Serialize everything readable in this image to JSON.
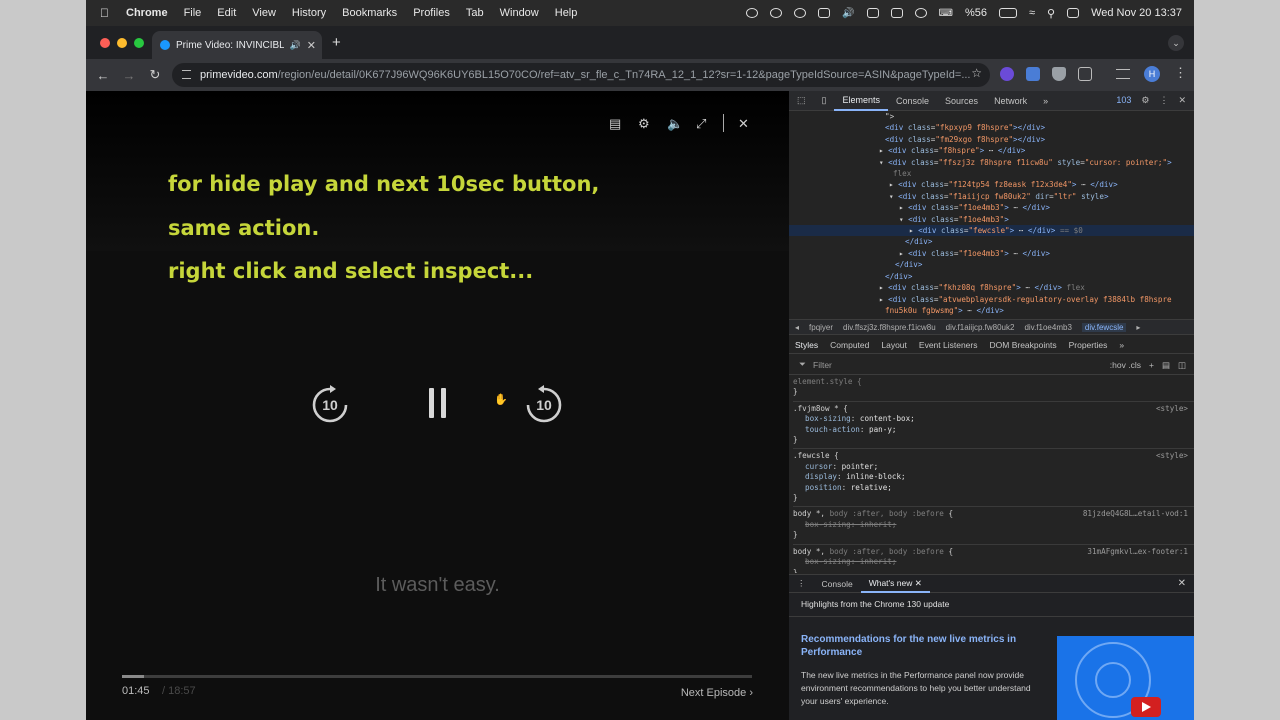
{
  "menubar": {
    "app": "Chrome",
    "items": [
      "File",
      "Edit",
      "View",
      "History",
      "Bookmarks",
      "Profiles",
      "Tab",
      "Window",
      "Help"
    ],
    "battery": "%56",
    "datetime": "Wed Nov 20  13:37"
  },
  "tab": {
    "title": "Prime Video: INVINCIBLE"
  },
  "address": {
    "host": "primevideo.com",
    "path": "/region/eu/detail/0K677J96WQ96K6UY6BL15O70CO/ref=atv_sr_fle_c_Tn74RA_12_1_12?sr=1-12&pageTypeIdSource=ASIN&pageTypeId=..."
  },
  "profile": {
    "initial": "H"
  },
  "video": {
    "caption_lines": [
      "for hide play and next 10sec button,",
      "same action.",
      "right click and select inspect..."
    ],
    "skip_back": "10",
    "skip_forward": "10",
    "subtitle": "It wasn't easy.",
    "time_current": "01:45",
    "time_total": "/ 18:57",
    "progress": 0.035,
    "next_episode": "Next Episode ›"
  },
  "devtools": {
    "tabs": [
      "Elements",
      "Console",
      "Sources",
      "Network"
    ],
    "issues_count": "103",
    "breadcrumbs": [
      "fpqiyer",
      "div.ffszj3z.f8hspre.f1icw8u",
      "div.f1aiijcp.fw80uk2",
      "div.f1oe4mb3",
      "div.fewcsle"
    ],
    "style_tabs": [
      "Styles",
      "Computed",
      "Layout",
      "Event Listeners",
      "DOM Breakpoints",
      "Properties"
    ],
    "filter_placeholder": "Filter",
    "filter_tools": ":hov  .cls",
    "drawer_tabs": [
      "Console",
      "What's new"
    ],
    "highlights": "Highlights from the Chrome 130 update",
    "card_title": "Recommendations for the new live metrics in Performance",
    "card_body": "The new live metrics in the Performance panel now provide environment recommendations to help you better understand your users' experience."
  },
  "colors": {
    "caption": "#c6d63a",
    "devtools_accent": "#8ab4f8"
  }
}
